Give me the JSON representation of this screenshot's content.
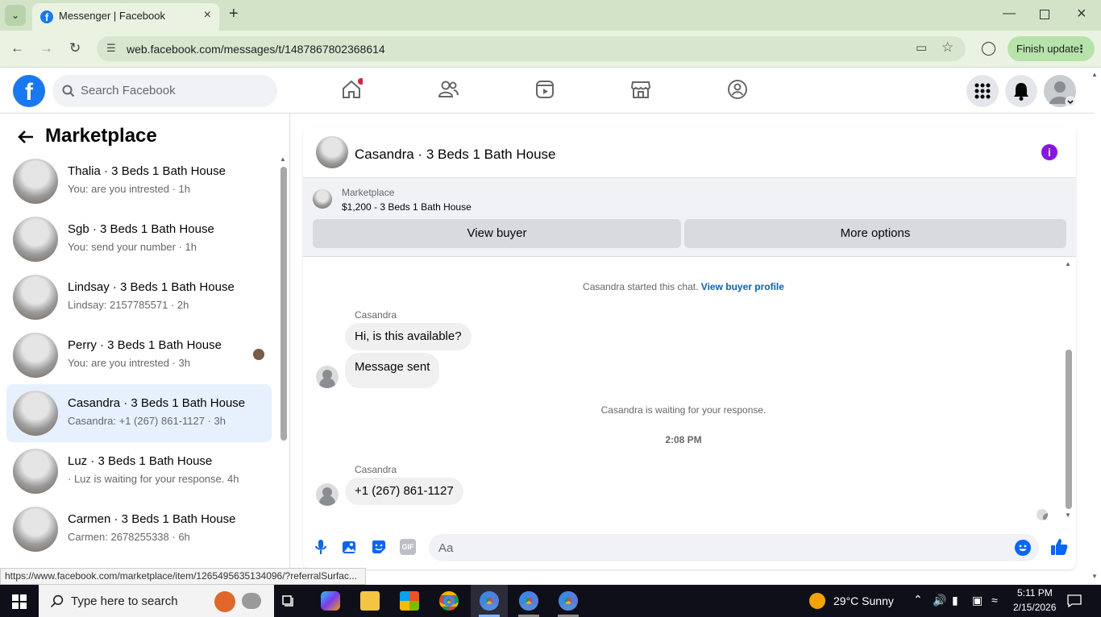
{
  "browser": {
    "tab_title": "Messenger | Facebook",
    "url": "web.facebook.com/messages/t/1487867802368614",
    "finish_update": "Finish update",
    "status_url": "https://www.facebook.com/marketplace/item/1265495635134096/?referralSurfac..."
  },
  "facebook": {
    "logo": "f",
    "search_placeholder": "Search Facebook"
  },
  "sidebar": {
    "title": "Marketplace",
    "conversations": [
      {
        "name": "Thalia · 3 Beds 1 Bath House",
        "preview": "You: are you intrested · 1h"
      },
      {
        "name": "Sgb · 3 Beds 1 Bath House",
        "preview": "You: send your number · 1h"
      },
      {
        "name": "Lindsay · 3 Beds 1 Bath House",
        "preview": "Lindsay: 2157785571 · 2h"
      },
      {
        "name": "Perry · 3 Beds 1 Bath House",
        "preview": "You: are you intrested · 3h"
      },
      {
        "name": "Casandra · 3 Beds 1 Bath House",
        "preview": "Casandra: +1 (267) 861-1127 · 3h"
      },
      {
        "name": "Luz · 3 Beds 1 Bath House",
        "preview": "· Luz is waiting for your response. 4h"
      },
      {
        "name": "Carmen · 3 Beds 1 Bath House",
        "preview": "Carmen: 2678255338 · 6h"
      }
    ]
  },
  "chat": {
    "title": "Casandra · 3 Beds 1 Bath House",
    "marketplace_label": "Marketplace",
    "listing": "$1,200 - 3 Beds 1 Bath House",
    "view_buyer": "View buyer",
    "more_options": "More options",
    "started": "Casandra started this chat.",
    "view_profile": "View buyer profile",
    "sender1": "Casandra",
    "msg1": "Hi, is this available?",
    "msg2": "Message sent",
    "waiting": "Casandra is waiting for your response.",
    "time": "2:08 PM",
    "sender2": "Casandra",
    "msg3": "+1 (267) 861-1127",
    "composer_placeholder": "Aa"
  },
  "taskbar": {
    "search_placeholder": "Type here to search",
    "weather": "29°C  Sunny",
    "clock_time": "5:11 PM",
    "clock_date": "2/15/2026"
  },
  "colors": {
    "fb_blue": "#1877f2",
    "info_purple": "#8a13e8",
    "active_row": "#e7f0fd"
  }
}
